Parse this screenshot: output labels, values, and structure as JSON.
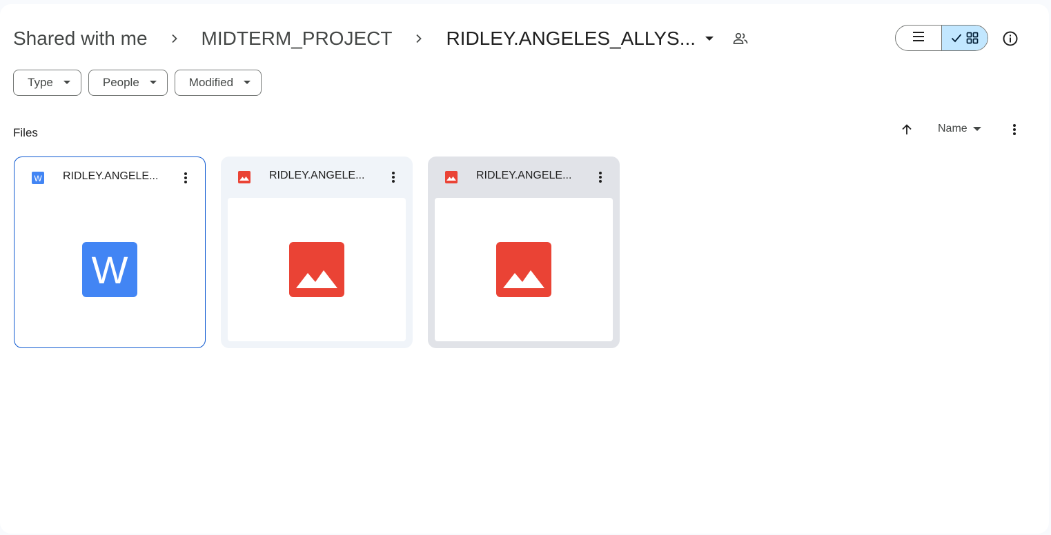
{
  "breadcrumb": {
    "items": [
      "Shared with me",
      "MIDTERM_PROJECT",
      "RIDLEY.ANGELES_ALLYS..."
    ]
  },
  "icons": {
    "breadcrumb_separator": "chevron-right-icon",
    "title_dropdown": "caret-down-icon",
    "shared": "people-icon",
    "list_view": "list-icon",
    "grid_view": "grid-icon",
    "check": "check-icon",
    "info": "info-icon",
    "sort_direction": "arrow-up-icon",
    "more": "more-vert-icon",
    "word": "word-doc-icon",
    "image": "image-icon"
  },
  "filters": [
    {
      "label": "Type"
    },
    {
      "label": "People"
    },
    {
      "label": "Modified"
    }
  ],
  "section": {
    "label": "Files",
    "sort_label": "Name"
  },
  "files": [
    {
      "name": "RIDLEY.ANGELE...",
      "type": "word",
      "state": "selected"
    },
    {
      "name": "RIDLEY.ANGELE...",
      "type": "image",
      "state": "normal"
    },
    {
      "name": "RIDLEY.ANGELE...",
      "type": "image",
      "state": "hover"
    }
  ],
  "colors": {
    "word_blue": "#4285f4",
    "image_red": "#ea4335",
    "selection_blue": "#0b57d0",
    "active_toggle": "#c2e7ff",
    "card_bg": "#f0f4f9",
    "card_hover_bg": "#e1e3e8"
  }
}
